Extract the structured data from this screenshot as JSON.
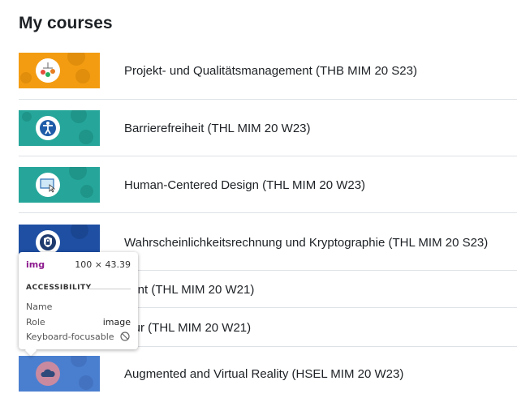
{
  "heading": "My courses",
  "courses": [
    {
      "name": "Projekt- und Qualitätsmanagement (THB MIM 20 S23)",
      "thumb_color": "#f39c12",
      "icon": "mobile-toy-icon"
    },
    {
      "name": "Barrierefreiheit (THL MIM 20 W23)",
      "thumb_color": "#26a69a",
      "icon": "accessibility-person-icon"
    },
    {
      "name": "Human-Centered Design (THL MIM 20 W23)",
      "thumb_color": "#26a69a",
      "icon": "screen-pointer-icon"
    },
    {
      "name": "Wahrscheinlichkeitsrechnung und Kryptographie (THL MIM 20 S23)",
      "thumb_color": "#1e4fa3",
      "icon": "shield-lock-icon"
    },
    {
      "name": "nent (THL MIM 20 W21)",
      "thumb_color": "#1e4fa3",
      "icon": ""
    },
    {
      "name": "ktur (THL MIM 20 W21)",
      "thumb_color": "#1e4fa3",
      "icon": ""
    },
    {
      "name": "Augmented and Virtual Reality (HSEL MIM 20 W23)",
      "thumb_color": "#4a7fd0",
      "icon": "cloud-icon"
    }
  ],
  "tooltip": {
    "tag": "img",
    "dims": "100 × 43.39",
    "section": "ACCESSIBILITY",
    "name_label": "Name",
    "role_label": "Role",
    "role_value": "image",
    "focus_label": "Keyboard-focusable",
    "focus_icon": "not-allowed-icon"
  }
}
